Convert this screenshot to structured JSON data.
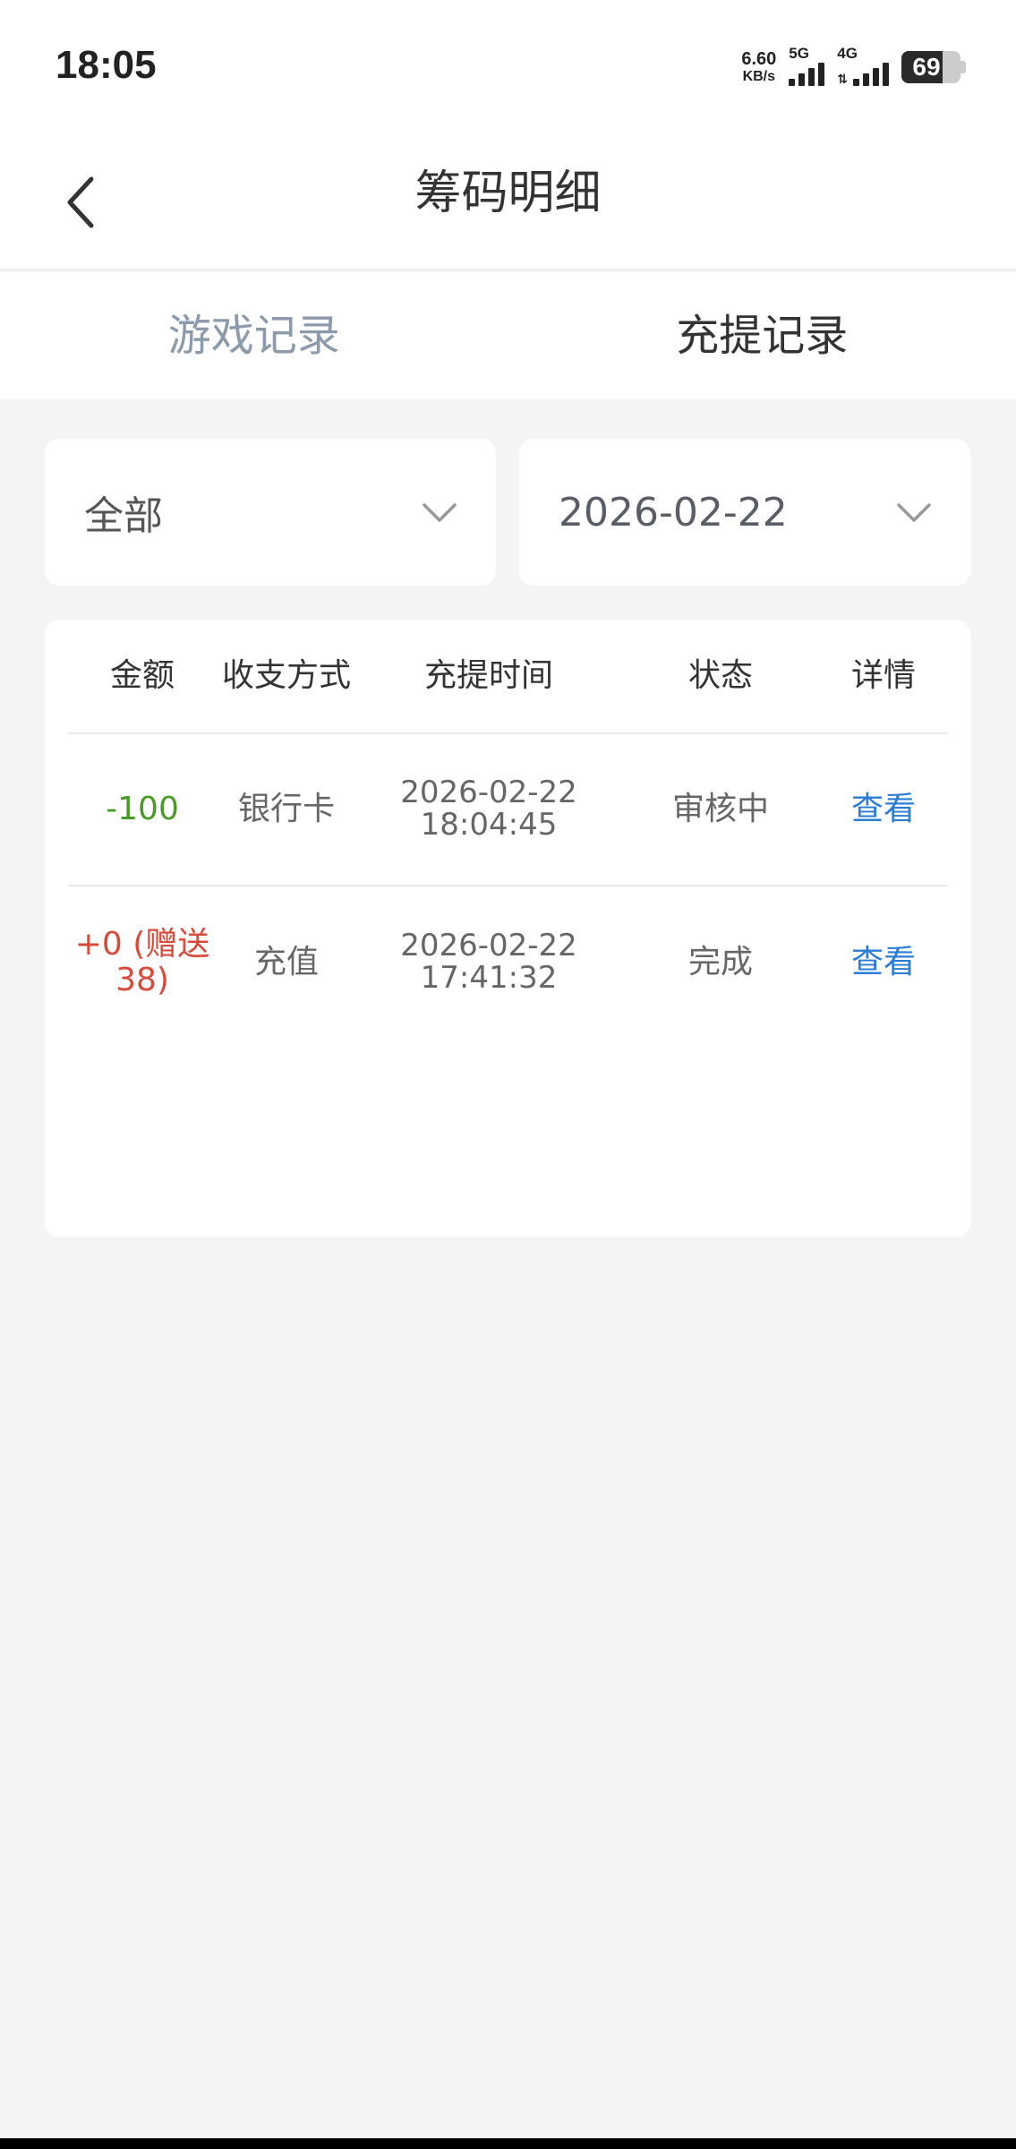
{
  "status_bar": {
    "time": "18:05",
    "net_speed_value": "6.60",
    "net_speed_unit": "KB/s",
    "signal1_label": "5G",
    "signal2_label": "4G",
    "battery_level": "69"
  },
  "header": {
    "title": "筹码明细",
    "back_icon": "chevron-left-icon"
  },
  "tabs": [
    {
      "label": "游戏记录",
      "active": false
    },
    {
      "label": "充提记录",
      "active": true
    }
  ],
  "filters": {
    "type": {
      "value": "全部",
      "icon": "chevron-down-icon"
    },
    "date": {
      "value": "2026-02-22",
      "icon": "chevron-down-icon"
    }
  },
  "table": {
    "columns": [
      "金额",
      "收支方式",
      "充提时间",
      "状态",
      "详情"
    ],
    "rows": [
      {
        "amount": "-100",
        "method": "银行卡",
        "date": "2026-02-22",
        "time": "18:04:45",
        "status": "审核中",
        "detail": "查看"
      },
      {
        "amount_line1": "+0 (赠送",
        "amount_line2": "38)",
        "method": "充值",
        "date": "2026-02-22",
        "time": "17:41:32",
        "status": "完成",
        "detail": "查看"
      }
    ]
  },
  "colors": {
    "negative_amount": "#4a9a2a",
    "positive_amount": "#d94a3a",
    "link": "#2a7cd6",
    "inactive_tab": "#8c9aab"
  }
}
